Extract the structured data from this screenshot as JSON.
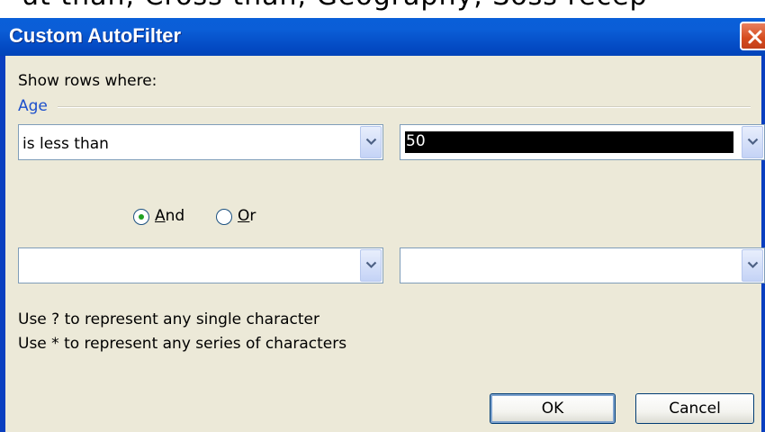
{
  "top_strip_text": "ut than, Cross than, Geography, Soss recep",
  "window": {
    "title": "Custom AutoFilter",
    "close_icon": "close-icon"
  },
  "dialog": {
    "show_rows_label": "Show rows where:",
    "field_name": "Age",
    "criteria1": {
      "operator": "is less than",
      "value": "50"
    },
    "logic": {
      "and_label": "And",
      "or_label": "Or",
      "selected": "And"
    },
    "criteria2": {
      "operator": "",
      "value": ""
    },
    "hint_single": "Use ? to represent any single character",
    "hint_series": "Use * to represent any series of characters",
    "ok_label": "OK",
    "cancel_label": "Cancel"
  },
  "colors": {
    "titlebar": "#0b5ed7",
    "close_button": "#d54b1d",
    "dialog_bg": "#ece9d8",
    "field_label": "#1c4fcc",
    "radio_dot": "#21a121"
  }
}
